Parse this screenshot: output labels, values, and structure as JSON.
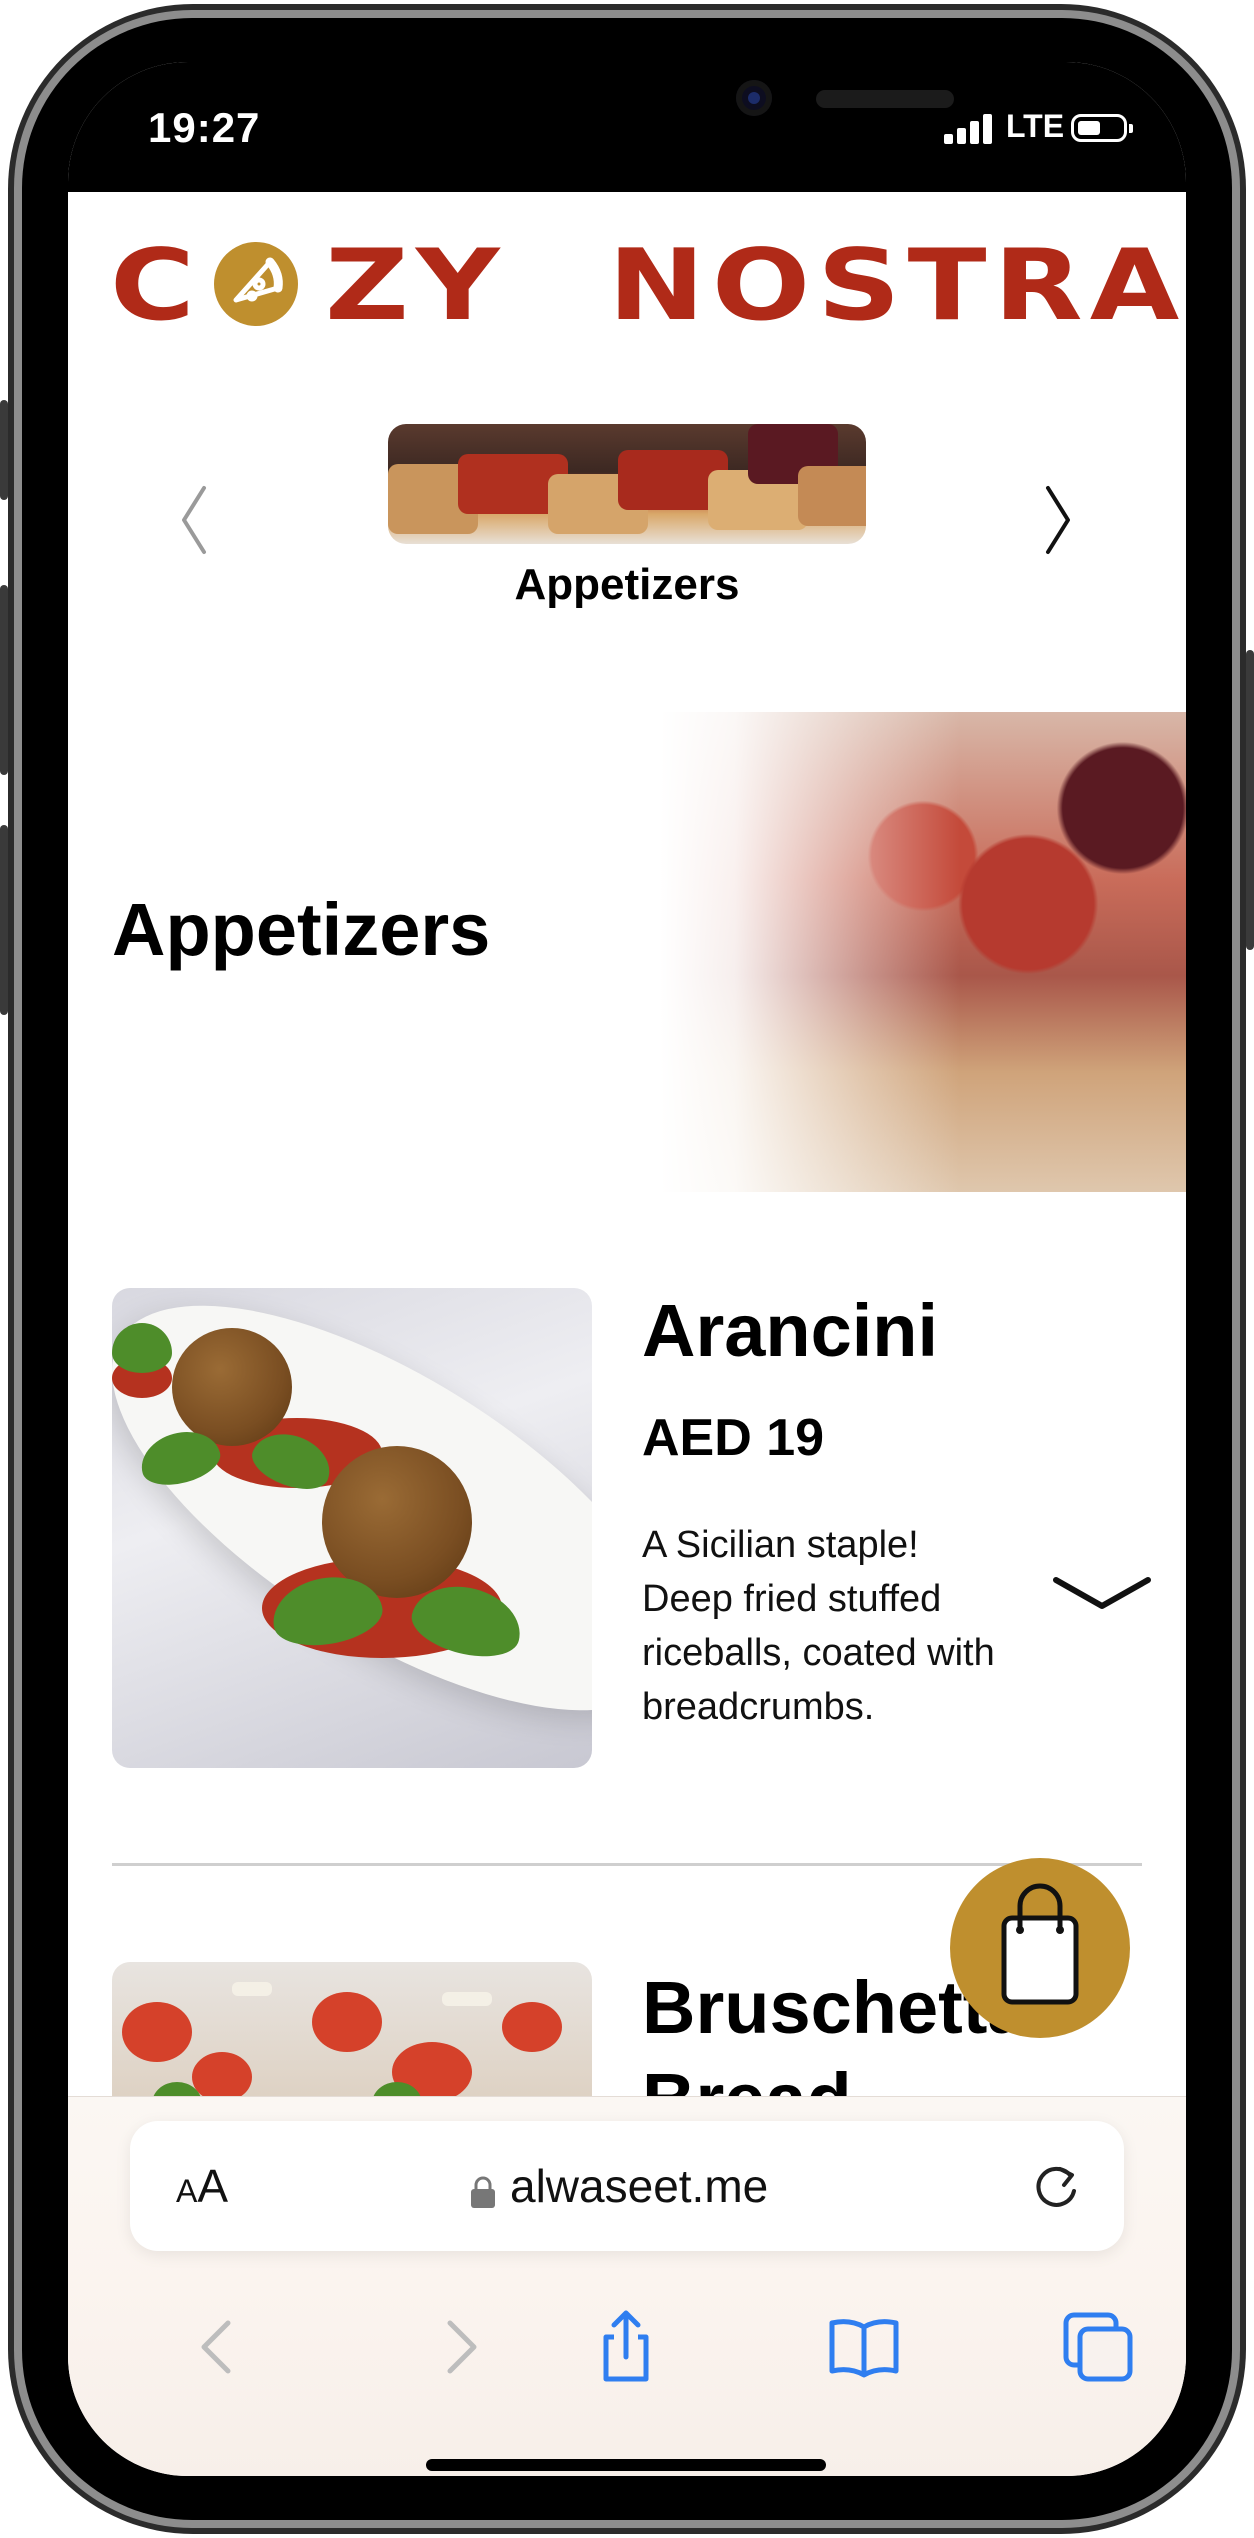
{
  "status_bar": {
    "time": "19:27",
    "network": "LTE"
  },
  "brand": {
    "logo_text": "COZY NOSTRA",
    "logo_c": "C",
    "logo_zy": "ZY",
    "logo_nostra": "NOSTRA",
    "brand_color": "#b02a18",
    "accent_color": "#bf8f2e"
  },
  "category_carousel": {
    "current_label": "Appetizers",
    "prev_icon": "chevron-left-icon",
    "next_icon": "chevron-right-icon"
  },
  "section": {
    "title": "Appetizers"
  },
  "menu_items": [
    {
      "name": "Arancini",
      "price": "AED 19",
      "description": "A Sicilian staple! Deep fried stuffed riceballs, coated with breadcrumbs.",
      "expand_icon": "chevron-down-icon"
    },
    {
      "name": "Bruschetta Bread"
    }
  ],
  "cart": {
    "icon": "shopping-bag-icon"
  },
  "browser": {
    "text_size_label": "AA",
    "url": "alwaseet.me",
    "toolbar_color": "#2f7ef0"
  }
}
